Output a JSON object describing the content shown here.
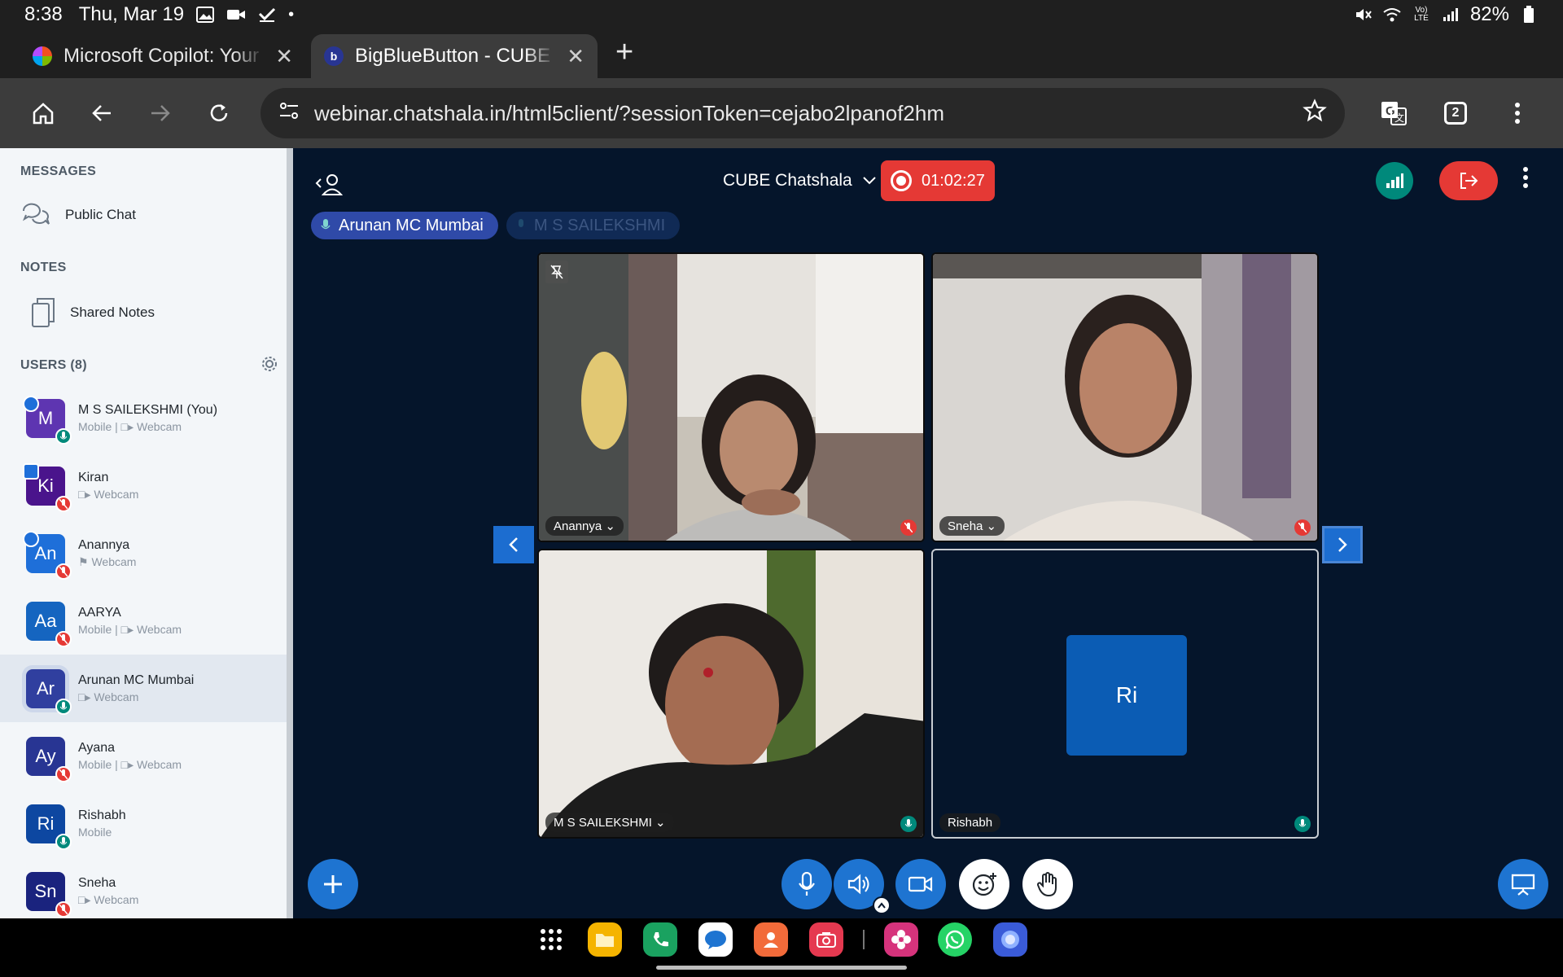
{
  "statusbar": {
    "time": "8:38",
    "date": "Thu, Mar 19",
    "battery": "82%"
  },
  "tabs": [
    {
      "title": "Microsoft Copilot: Your AI",
      "active": false
    },
    {
      "title": "BigBlueButton - CUBE Cha",
      "active": true
    }
  ],
  "omnibox": {
    "url": "webinar.chatshala.in/html5client/?sessionToken=cejabo2lpanof2hm"
  },
  "browser": {
    "tab_count": "2"
  },
  "sidebar": {
    "messages_title": "MESSAGES",
    "public_chat": "Public Chat",
    "notes_title": "NOTES",
    "shared_notes": "Shared Notes",
    "users_title": "USERS (8)",
    "users": [
      {
        "initials": "M",
        "name": "M S SAILEKSHMI (You)",
        "sub": "Mobile | □▸ Webcam",
        "color": "#5e35b1",
        "mic": "on",
        "tag": "edit"
      },
      {
        "initials": "Ki",
        "name": "Kiran",
        "sub": "□▸ Webcam",
        "color": "#4a148c",
        "mic": "off",
        "tag": "presenter"
      },
      {
        "initials": "An",
        "name": "Anannya",
        "sub": "⚑ Webcam",
        "color": "#1e6fd9",
        "mic": "off",
        "tag": "edit"
      },
      {
        "initials": "Aa",
        "name": "AARYA",
        "sub": "Mobile | □▸ Webcam",
        "color": "#1565c0",
        "mic": "off",
        "tag": ""
      },
      {
        "initials": "Ar",
        "name": "Arunan MC Mumbai",
        "sub": "□▸ Webcam",
        "color": "#303f9f",
        "mic": "on",
        "tag": "",
        "highlight": true
      },
      {
        "initials": "Ay",
        "name": "Ayana",
        "sub": "Mobile | □▸ Webcam",
        "color": "#283593",
        "mic": "off",
        "tag": ""
      },
      {
        "initials": "Ri",
        "name": "Rishabh",
        "sub": "Mobile",
        "color": "#0d47a1",
        "mic": "on",
        "tag": ""
      },
      {
        "initials": "Sn",
        "name": "Sneha",
        "sub": "□▸ Webcam",
        "color": "#1a237e",
        "mic": "off",
        "tag": ""
      }
    ]
  },
  "main": {
    "session_name": "CUBE Chatshala",
    "recording_time": "01:02:27",
    "talking": [
      {
        "name": "Arunan MC Mumbai",
        "active": true
      },
      {
        "name": "M S SAILEKSHMI",
        "active": false
      }
    ],
    "videos": [
      {
        "name": "Anannya",
        "mic": "off",
        "kind": "cam1"
      },
      {
        "name": "Sneha",
        "mic": "off",
        "kind": "cam2"
      },
      {
        "name": "M S SAILEKSHMI",
        "mic": "on",
        "kind": "cam3"
      },
      {
        "name": "Rishabh",
        "mic": "on",
        "kind": "avatar",
        "initials": "Ri"
      }
    ]
  },
  "colors": {
    "brand_blue": "#1e74d1",
    "record_red": "#e53935",
    "main_bg": "#05152b"
  }
}
